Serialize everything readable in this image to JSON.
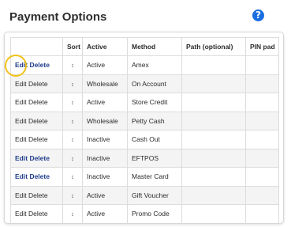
{
  "header": {
    "title": "Payment Options",
    "help_glyph": "?"
  },
  "table": {
    "columns": [
      "",
      "Sort",
      "Active",
      "Method",
      "Path (optional)",
      "PIN pad"
    ],
    "edit_label": "Edit",
    "delete_label": "Delete",
    "sort_glyph": "↕",
    "rows": [
      {
        "active": "Active",
        "method": "Amex",
        "path": "",
        "pin_pad": "",
        "links_highlighted": true
      },
      {
        "active": "Wholesale",
        "method": "On Account",
        "path": "",
        "pin_pad": "",
        "links_highlighted": false
      },
      {
        "active": "Active",
        "method": "Store Credit",
        "path": "",
        "pin_pad": "",
        "links_highlighted": false
      },
      {
        "active": "Wholesale",
        "method": "Petty Cash",
        "path": "",
        "pin_pad": "",
        "links_highlighted": false
      },
      {
        "active": "Inactive",
        "method": "Cash Out",
        "path": "",
        "pin_pad": "",
        "links_highlighted": false
      },
      {
        "active": "Inactive",
        "method": "EFTPOS",
        "path": "",
        "pin_pad": "",
        "links_highlighted": true
      },
      {
        "active": "Inactive",
        "method": "Master Card",
        "path": "",
        "pin_pad": "",
        "links_highlighted": true
      },
      {
        "active": "Active",
        "method": "Gift Voucher",
        "path": "",
        "pin_pad": "",
        "links_highlighted": false
      },
      {
        "active": "Active",
        "method": "Promo Code",
        "path": "",
        "pin_pad": "",
        "links_highlighted": false
      }
    ]
  },
  "colors": {
    "link": "#1f3d8a",
    "help": "#1a6fe0",
    "highlight_ring": "#f2c21b"
  }
}
